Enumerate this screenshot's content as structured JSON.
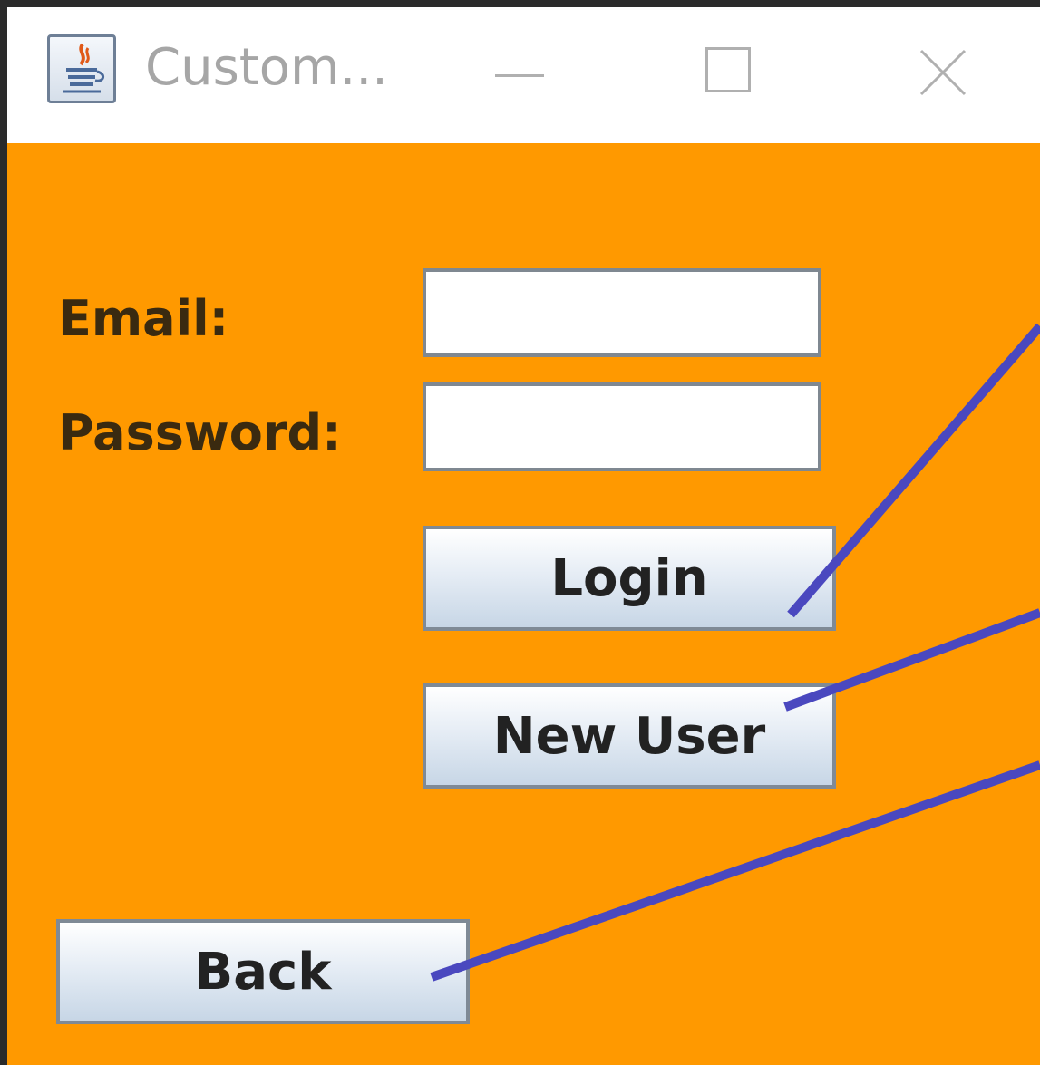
{
  "window": {
    "title": "Custom...",
    "background_color": "#ff9900",
    "title_icon": "java-app-icon",
    "controls": {
      "minimize": "minimize-icon",
      "maximize": "maximize-icon",
      "close": "close-icon"
    }
  },
  "form": {
    "email_label": "Email:",
    "email_value": "",
    "password_label": "Password:",
    "password_value": ""
  },
  "buttons": {
    "login": "Login",
    "new_user": "New User",
    "back": "Back"
  },
  "annotations": {
    "line_color": "#4a48bf"
  }
}
